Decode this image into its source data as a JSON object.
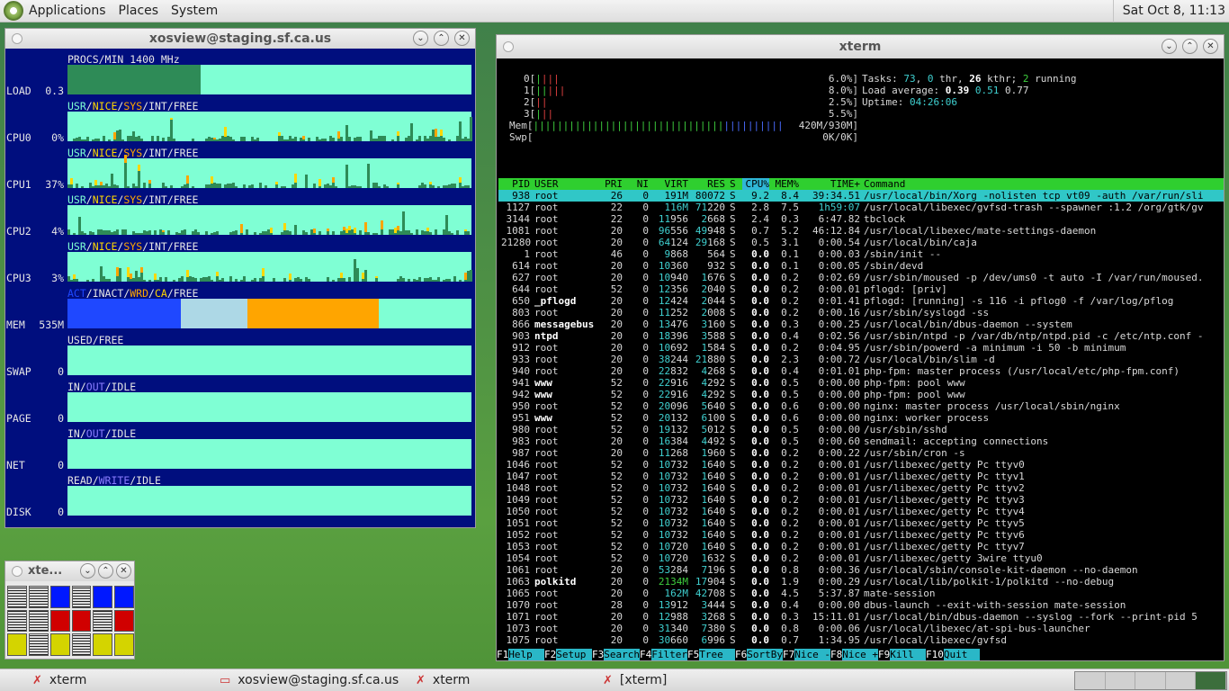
{
  "top_panel": {
    "menus": [
      "Applications",
      "Places",
      "System"
    ],
    "clock": "Sat Oct  8, 11:13"
  },
  "xosview": {
    "title": "xosview@staging.sf.ca.us",
    "meters": [
      {
        "name": "LOAD",
        "value": "0.3",
        "legend": [
          [
            "PROCS/MIN 1400 MHz",
            "c-free"
          ]
        ],
        "kind": "load",
        "level": 0.33
      },
      {
        "name": "CPU0",
        "value": "0%",
        "legend": [
          [
            "USR",
            "c-usr"
          ],
          [
            "/",
            "c-free"
          ],
          [
            "NICE",
            "c-nice"
          ],
          [
            "/",
            "c-free"
          ],
          [
            "SYS",
            "c-sys"
          ],
          [
            "/INT/FREE",
            "c-free"
          ]
        ],
        "kind": "cpu",
        "seed": 3
      },
      {
        "name": "CPU1",
        "value": "37%",
        "legend": [
          [
            "USR",
            "c-usr"
          ],
          [
            "/",
            "c-free"
          ],
          [
            "NICE",
            "c-nice"
          ],
          [
            "/",
            "c-free"
          ],
          [
            "SYS",
            "c-sys"
          ],
          [
            "/INT/FREE",
            "c-free"
          ]
        ],
        "kind": "cpu",
        "seed": 7
      },
      {
        "name": "CPU2",
        "value": "4%",
        "legend": [
          [
            "USR",
            "c-usr"
          ],
          [
            "/",
            "c-free"
          ],
          [
            "NICE",
            "c-nice"
          ],
          [
            "/",
            "c-free"
          ],
          [
            "SYS",
            "c-sys"
          ],
          [
            "/INT/FREE",
            "c-free"
          ]
        ],
        "kind": "cpu",
        "seed": 11
      },
      {
        "name": "CPU3",
        "value": "3%",
        "legend": [
          [
            "USR",
            "c-usr"
          ],
          [
            "/",
            "c-free"
          ],
          [
            "NICE",
            "c-nice"
          ],
          [
            "/",
            "c-free"
          ],
          [
            "SYS",
            "c-sys"
          ],
          [
            "/INT/FREE",
            "c-free"
          ]
        ],
        "kind": "cpu",
        "seed": 17
      },
      {
        "name": "MEM",
        "value": "535M",
        "legend": [
          [
            "ACT",
            "c-act"
          ],
          [
            "/INACT/",
            "c-free"
          ],
          [
            "WRD",
            "c-wrd"
          ],
          [
            "/",
            "c-free"
          ],
          [
            "CA",
            "c-ca"
          ],
          [
            "/FREE",
            "c-free"
          ]
        ],
        "kind": "mem",
        "parts": [
          0.28,
          0.165,
          0.325,
          0.23
        ]
      },
      {
        "name": "SWAP",
        "value": "0",
        "legend": [
          [
            "USED/FREE",
            "c-free"
          ]
        ],
        "kind": "empty"
      },
      {
        "name": "PAGE",
        "value": "0",
        "legend": [
          [
            "IN/",
            "c-free"
          ],
          [
            "OUT",
            "c-out"
          ],
          [
            "/IDLE",
            "c-free"
          ]
        ],
        "kind": "empty"
      },
      {
        "name": "NET",
        "value": "0",
        "legend": [
          [
            "IN/",
            "c-free"
          ],
          [
            "OUT",
            "c-out"
          ],
          [
            "/IDLE",
            "c-free"
          ]
        ],
        "kind": "empty"
      },
      {
        "name": "DISK",
        "value": "0",
        "legend": [
          [
            "READ/",
            "c-free"
          ],
          [
            "WRITE",
            "c-write"
          ],
          [
            "/IDLE",
            "c-free"
          ]
        ],
        "kind": "empty"
      }
    ],
    "colors": {
      "free": "#7fffd4",
      "usr": "#2e8b57",
      "nice": "#ffd700",
      "sys": "#ffa500",
      "act": "#1f48ff",
      "inact": "#add8e6",
      "wrd": "#ffa500"
    }
  },
  "xterm_small": {
    "title": "xte...",
    "cells": [
      "#ccc",
      "#ccc",
      "#0018ff",
      "#ccc",
      "#0018ff",
      "#0018ff",
      "#ccc",
      "#ccc",
      "#d00000",
      "#d00000",
      "#ccc",
      "#d00000",
      "#d4d400",
      "#ccc",
      "#d4d400",
      "#ccc",
      "#d4d400",
      "#d4d400"
    ]
  },
  "xterm": {
    "title": "xterm",
    "cpus": [
      {
        "label": "0",
        "ticks_g": "|",
        "ticks_r": "|||",
        "pct": "6.0%"
      },
      {
        "label": "1",
        "ticks_g": "||",
        "ticks_r": "|||",
        "pct": "8.0%"
      },
      {
        "label": "2",
        "ticks_g": "",
        "ticks_r": "||",
        "pct": "2.5%"
      },
      {
        "label": "3",
        "ticks_g": "|",
        "ticks_r": "||",
        "pct": "5.5%"
      }
    ],
    "mem": {
      "label": "Mem",
      "ticks_g": "||||||||||||||||||||||||||||||||",
      "ticks_b": "||||||||||",
      "value": "420M/930M"
    },
    "swp": {
      "label": "Swp",
      "value": "0K/0K"
    },
    "tasks": {
      "label": "Tasks: ",
      "tasks": "73",
      "sep1": ", ",
      "thr": "0",
      "thr_l": " thr, ",
      "kthr": "26",
      "kthr_l": " kthr; ",
      "running": "2",
      "running_l": " running"
    },
    "load": {
      "label": "Load average: ",
      "l1": "0.39",
      "l5": "0.51",
      "l15": "0.77"
    },
    "uptime": {
      "label": "Uptime: ",
      "value": "04:26:06"
    },
    "headers": {
      "pid": "PID",
      "user": "USER",
      "pri": "PRI",
      "ni": "NI",
      "virt": "VIRT",
      "res": "RES",
      "s": "S",
      "cpu": "CPU%",
      "mem": "MEM%",
      "time": "TIME+",
      "cmd": "Command"
    },
    "processes": [
      [
        "938",
        "root",
        "26",
        "0",
        "191M",
        "80072",
        "S",
        "9.2",
        "8.4",
        "39:34.51",
        "/usr/local/bin/Xorg -nolisten tcp vt09 -auth /var/run/sli"
      ],
      [
        "1127",
        "root",
        "22",
        "0",
        "116M",
        "71220",
        "S",
        "2.8",
        "7.5",
        "1h59:07",
        "/usr/local/libexec/gvfsd-trash --spawner :1.2 /org/gtk/gv"
      ],
      [
        "3144",
        "root",
        "22",
        "0",
        "11956",
        "2668",
        "S",
        "2.4",
        "0.3",
        "6:47.82",
        "tbclock"
      ],
      [
        "1081",
        "root",
        "20",
        "0",
        "96556",
        "49948",
        "S",
        "0.7",
        "5.2",
        "46:12.84",
        "/usr/local/libexec/mate-settings-daemon"
      ],
      [
        "21280",
        "root",
        "20",
        "0",
        "64124",
        "29168",
        "S",
        "0.5",
        "3.1",
        "0:00.54",
        "/usr/local/bin/caja"
      ],
      [
        "1",
        "root",
        "46",
        "0",
        "9868",
        "564",
        "S",
        "0.0",
        "0.1",
        "0:00.03",
        "/sbin/init --"
      ],
      [
        "614",
        "root",
        "20",
        "0",
        "10360",
        "932",
        "S",
        "0.0",
        "0.1",
        "0:00.05",
        "/sbin/devd"
      ],
      [
        "627",
        "root",
        "20",
        "0",
        "10940",
        "1676",
        "S",
        "0.0",
        "0.2",
        "0:02.69",
        "/usr/sbin/moused -p /dev/ums0 -t auto -I /var/run/moused."
      ],
      [
        "644",
        "root",
        "52",
        "0",
        "12356",
        "2040",
        "S",
        "0.0",
        "0.2",
        "0:00.01",
        "pflogd: [priv]"
      ],
      [
        "650",
        "_pflogd",
        "20",
        "0",
        "12424",
        "2044",
        "S",
        "0.0",
        "0.2",
        "0:01.41",
        "pflogd: [running] -s 116 -i pflog0 -f /var/log/pflog"
      ],
      [
        "803",
        "root",
        "20",
        "0",
        "11252",
        "2008",
        "S",
        "0.0",
        "0.2",
        "0:00.16",
        "/usr/sbin/syslogd -ss"
      ],
      [
        "866",
        "messagebus",
        "20",
        "0",
        "13476",
        "3160",
        "S",
        "0.0",
        "0.3",
        "0:00.25",
        "/usr/local/bin/dbus-daemon --system"
      ],
      [
        "903",
        "ntpd",
        "20",
        "0",
        "18396",
        "3588",
        "S",
        "0.0",
        "0.4",
        "0:02.56",
        "/usr/sbin/ntpd -p /var/db/ntp/ntpd.pid -c /etc/ntp.conf -"
      ],
      [
        "912",
        "root",
        "20",
        "0",
        "10692",
        "1584",
        "S",
        "0.0",
        "0.2",
        "0:04.95",
        "/usr/sbin/powerd -a minimum -i 50 -b minimum"
      ],
      [
        "933",
        "root",
        "20",
        "0",
        "38244",
        "21880",
        "S",
        "0.0",
        "2.3",
        "0:00.72",
        "/usr/local/bin/slim -d"
      ],
      [
        "940",
        "root",
        "20",
        "0",
        "22832",
        "4268",
        "S",
        "0.0",
        "0.4",
        "0:01.01",
        "php-fpm: master process (/usr/local/etc/php-fpm.conf)"
      ],
      [
        "941",
        "www",
        "52",
        "0",
        "22916",
        "4292",
        "S",
        "0.0",
        "0.5",
        "0:00.00",
        "php-fpm: pool www"
      ],
      [
        "942",
        "www",
        "52",
        "0",
        "22916",
        "4292",
        "S",
        "0.0",
        "0.5",
        "0:00.00",
        "php-fpm: pool www"
      ],
      [
        "950",
        "root",
        "52",
        "0",
        "20096",
        "5640",
        "S",
        "0.0",
        "0.6",
        "0:00.00",
        "nginx: master process /usr/local/sbin/nginx"
      ],
      [
        "951",
        "www",
        "52",
        "0",
        "20132",
        "6100",
        "S",
        "0.0",
        "0.6",
        "0:00.00",
        "nginx: worker process"
      ],
      [
        "980",
        "root",
        "52",
        "0",
        "19132",
        "5012",
        "S",
        "0.0",
        "0.5",
        "0:00.00",
        "/usr/sbin/sshd"
      ],
      [
        "983",
        "root",
        "20",
        "0",
        "16384",
        "4492",
        "S",
        "0.0",
        "0.5",
        "0:00.60",
        "sendmail: accepting connections"
      ],
      [
        "987",
        "root",
        "20",
        "0",
        "11268",
        "1960",
        "S",
        "0.0",
        "0.2",
        "0:00.22",
        "/usr/sbin/cron -s"
      ],
      [
        "1046",
        "root",
        "52",
        "0",
        "10732",
        "1640",
        "S",
        "0.0",
        "0.2",
        "0:00.01",
        "/usr/libexec/getty Pc ttyv0"
      ],
      [
        "1047",
        "root",
        "52",
        "0",
        "10732",
        "1640",
        "S",
        "0.0",
        "0.2",
        "0:00.01",
        "/usr/libexec/getty Pc ttyv1"
      ],
      [
        "1048",
        "root",
        "52",
        "0",
        "10732",
        "1640",
        "S",
        "0.0",
        "0.2",
        "0:00.01",
        "/usr/libexec/getty Pc ttyv2"
      ],
      [
        "1049",
        "root",
        "52",
        "0",
        "10732",
        "1640",
        "S",
        "0.0",
        "0.2",
        "0:00.01",
        "/usr/libexec/getty Pc ttyv3"
      ],
      [
        "1050",
        "root",
        "52",
        "0",
        "10732",
        "1640",
        "S",
        "0.0",
        "0.2",
        "0:00.01",
        "/usr/libexec/getty Pc ttyv4"
      ],
      [
        "1051",
        "root",
        "52",
        "0",
        "10732",
        "1640",
        "S",
        "0.0",
        "0.2",
        "0:00.01",
        "/usr/libexec/getty Pc ttyv5"
      ],
      [
        "1052",
        "root",
        "52",
        "0",
        "10732",
        "1640",
        "S",
        "0.0",
        "0.2",
        "0:00.01",
        "/usr/libexec/getty Pc ttyv6"
      ],
      [
        "1053",
        "root",
        "52",
        "0",
        "10720",
        "1640",
        "S",
        "0.0",
        "0.2",
        "0:00.01",
        "/usr/libexec/getty Pc ttyv7"
      ],
      [
        "1054",
        "root",
        "52",
        "0",
        "10720",
        "1632",
        "S",
        "0.0",
        "0.2",
        "0:00.01",
        "/usr/libexec/getty 3wire ttyu0"
      ],
      [
        "1061",
        "root",
        "20",
        "0",
        "53284",
        "7196",
        "S",
        "0.0",
        "0.8",
        "0:00.36",
        "/usr/local/sbin/console-kit-daemon --no-daemon"
      ],
      [
        "1063",
        "polkitd",
        "20",
        "0",
        "2134M",
        "17904",
        "S",
        "0.0",
        "1.9",
        "0:00.29",
        "/usr/local/lib/polkit-1/polkitd --no-debug"
      ],
      [
        "1065",
        "root",
        "20",
        "0",
        "162M",
        "42708",
        "S",
        "0.0",
        "4.5",
        "5:37.87",
        "mate-session"
      ],
      [
        "1070",
        "root",
        "28",
        "0",
        "13912",
        "3444",
        "S",
        "0.0",
        "0.4",
        "0:00.00",
        "dbus-launch --exit-with-session mate-session"
      ],
      [
        "1071",
        "root",
        "20",
        "0",
        "12988",
        "3268",
        "S",
        "0.0",
        "0.3",
        "15:11.01",
        "/usr/local/bin/dbus-daemon --syslog --fork --print-pid 5"
      ],
      [
        "1073",
        "root",
        "20",
        "0",
        "31340",
        "7380",
        "S",
        "0.0",
        "0.8",
        "0:00.06",
        "/usr/local/libexec/at-spi-bus-launcher"
      ],
      [
        "1075",
        "root",
        "20",
        "0",
        "30660",
        "6996",
        "S",
        "0.0",
        "0.7",
        "1:34.95",
        "/usr/local/libexec/gvfsd"
      ]
    ],
    "fkeys": [
      [
        "F1",
        "Help  "
      ],
      [
        "F2",
        "Setup "
      ],
      [
        "F3",
        "Search"
      ],
      [
        "F4",
        "Filter"
      ],
      [
        "F5",
        "Tree  "
      ],
      [
        "F6",
        "SortBy"
      ],
      [
        "F7",
        "Nice -"
      ],
      [
        "F8",
        "Nice +"
      ],
      [
        "F9",
        "Kill  "
      ],
      [
        "F10",
        "Quit  "
      ]
    ]
  },
  "taskbar": {
    "tasks": [
      {
        "label": "xterm",
        "icon": "xterm-icon"
      },
      {
        "label": "xosview@staging.sf.ca.us",
        "icon": "window-icon"
      },
      {
        "label": "xterm",
        "icon": "xterm-icon"
      },
      {
        "label": "[xterm]",
        "icon": "xterm-icon"
      }
    ]
  }
}
